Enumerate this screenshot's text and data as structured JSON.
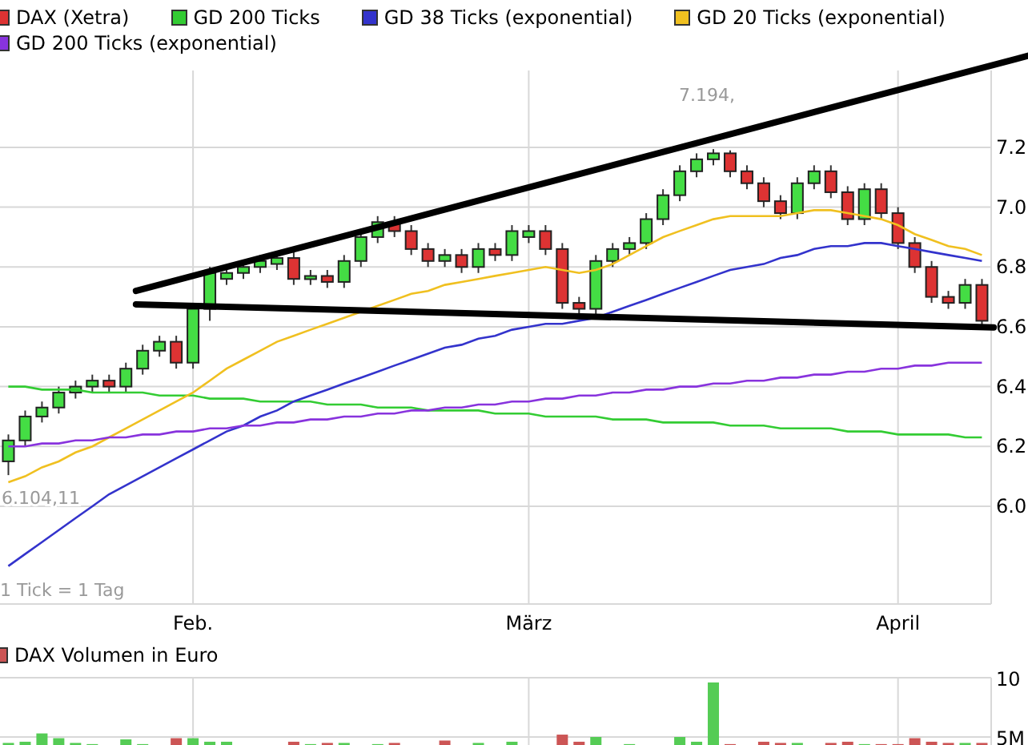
{
  "price_chart": {
    "main_series": {
      "name": "DAX (Xetra)",
      "color": "#dd3333"
    },
    "chart_data": {
      "type": "candlestick",
      "categories": [
        null,
        null,
        null,
        null,
        null,
        null,
        null,
        null,
        null,
        null,
        null,
        "Feb.",
        null,
        null,
        null,
        null,
        null,
        null,
        null,
        null,
        null,
        null,
        null,
        null,
        null,
        null,
        null,
        null,
        null,
        null,
        null,
        "März",
        null,
        null,
        null,
        null,
        null,
        null,
        null,
        null,
        null,
        null,
        null,
        null,
        null,
        null,
        null,
        null,
        null,
        null,
        null,
        null,
        null,
        "April",
        null,
        null,
        null,
        null,
        null
      ],
      "ylim": [
        5.673,
        7.457
      ],
      "grid": true,
      "yticks": [
        {
          "value": 7.2,
          "label": "7.2"
        },
        {
          "value": 7.0,
          "label": "7.0"
        },
        {
          "value": 6.8,
          "label": "6.8"
        },
        {
          "value": 6.6,
          "label": "6.6"
        },
        {
          "value": 6.4,
          "label": "6.4"
        },
        {
          "value": 6.2,
          "label": "6.2"
        },
        {
          "value": 6.0,
          "label": "6.0"
        }
      ],
      "ohlc": [
        [
          6.15,
          6.24,
          6.104,
          6.22
        ],
        [
          6.22,
          6.32,
          6.2,
          6.3
        ],
        [
          6.3,
          6.35,
          6.28,
          6.33
        ],
        [
          6.33,
          6.4,
          6.31,
          6.38
        ],
        [
          6.38,
          6.42,
          6.36,
          6.4
        ],
        [
          6.4,
          6.44,
          6.38,
          6.42
        ],
        [
          6.42,
          6.44,
          6.38,
          6.4
        ],
        [
          6.4,
          6.48,
          6.38,
          6.46
        ],
        [
          6.46,
          6.54,
          6.44,
          6.52
        ],
        [
          6.52,
          6.57,
          6.5,
          6.55
        ],
        [
          6.55,
          6.57,
          6.46,
          6.48
        ],
        [
          6.48,
          6.68,
          6.46,
          6.66
        ],
        [
          6.66,
          6.8,
          6.62,
          6.78
        ],
        [
          6.76,
          6.8,
          6.74,
          6.78
        ],
        [
          6.78,
          6.82,
          6.76,
          6.8
        ],
        [
          6.8,
          6.84,
          6.78,
          6.82
        ],
        [
          6.81,
          6.85,
          6.79,
          6.83
        ],
        [
          6.83,
          6.85,
          6.74,
          6.76
        ],
        [
          6.76,
          6.79,
          6.74,
          6.77
        ],
        [
          6.77,
          6.79,
          6.73,
          6.75
        ],
        [
          6.75,
          6.84,
          6.73,
          6.82
        ],
        [
          6.82,
          6.92,
          6.8,
          6.9
        ],
        [
          6.9,
          6.97,
          6.88,
          6.95
        ],
        [
          6.95,
          6.97,
          6.9,
          6.92
        ],
        [
          6.92,
          6.94,
          6.84,
          6.86
        ],
        [
          6.86,
          6.88,
          6.8,
          6.82
        ],
        [
          6.82,
          6.86,
          6.8,
          6.84
        ],
        [
          6.84,
          6.86,
          6.78,
          6.8
        ],
        [
          6.8,
          6.88,
          6.78,
          6.86
        ],
        [
          6.86,
          6.88,
          6.82,
          6.84
        ],
        [
          6.84,
          6.94,
          6.82,
          6.92
        ],
        [
          6.9,
          6.94,
          6.88,
          6.92
        ],
        [
          6.92,
          6.94,
          6.84,
          6.86
        ],
        [
          6.86,
          6.88,
          6.66,
          6.68
        ],
        [
          6.68,
          6.7,
          6.64,
          6.66
        ],
        [
          6.66,
          6.84,
          6.64,
          6.82
        ],
        [
          6.82,
          6.88,
          6.8,
          6.86
        ],
        [
          6.86,
          6.9,
          6.84,
          6.88
        ],
        [
          6.88,
          6.98,
          6.86,
          6.96
        ],
        [
          6.96,
          7.06,
          6.94,
          7.04
        ],
        [
          7.04,
          7.14,
          7.02,
          7.12
        ],
        [
          7.12,
          7.18,
          7.1,
          7.16
        ],
        [
          7.16,
          7.194,
          7.14,
          7.18
        ],
        [
          7.18,
          7.19,
          7.1,
          7.12
        ],
        [
          7.12,
          7.14,
          7.06,
          7.08
        ],
        [
          7.08,
          7.1,
          7.0,
          7.02
        ],
        [
          7.02,
          7.04,
          6.96,
          6.98
        ],
        [
          6.98,
          7.1,
          6.96,
          7.08
        ],
        [
          7.08,
          7.14,
          7.06,
          7.12
        ],
        [
          7.12,
          7.14,
          7.03,
          7.05
        ],
        [
          7.05,
          7.07,
          6.94,
          6.96
        ],
        [
          6.96,
          7.08,
          6.94,
          7.06
        ],
        [
          7.06,
          7.08,
          6.96,
          6.98
        ],
        [
          6.98,
          7.0,
          6.86,
          6.88
        ],
        [
          6.88,
          6.9,
          6.78,
          6.8
        ],
        [
          6.8,
          6.82,
          6.68,
          6.7
        ],
        [
          6.7,
          6.72,
          6.66,
          6.68
        ],
        [
          6.68,
          6.76,
          6.66,
          6.74
        ],
        [
          6.74,
          6.76,
          6.6,
          6.62
        ]
      ],
      "series": [
        {
          "name": "GD 200 Ticks",
          "type": "line",
          "color": "#33cc33",
          "values": [
            6.4,
            6.4,
            6.39,
            6.39,
            6.39,
            6.38,
            6.38,
            6.38,
            6.38,
            6.37,
            6.37,
            6.37,
            6.36,
            6.36,
            6.36,
            6.35,
            6.35,
            6.35,
            6.35,
            6.34,
            6.34,
            6.34,
            6.33,
            6.33,
            6.33,
            6.32,
            6.32,
            6.32,
            6.32,
            6.31,
            6.31,
            6.31,
            6.3,
            6.3,
            6.3,
            6.3,
            6.29,
            6.29,
            6.29,
            6.28,
            6.28,
            6.28,
            6.28,
            6.27,
            6.27,
            6.27,
            6.26,
            6.26,
            6.26,
            6.26,
            6.25,
            6.25,
            6.25,
            6.24,
            6.24,
            6.24,
            6.24,
            6.23,
            6.23
          ]
        },
        {
          "name": "GD 38 Ticks (exponential)",
          "type": "line",
          "color": "#3333cc",
          "values": [
            5.8,
            5.84,
            5.88,
            5.92,
            5.96,
            6.0,
            6.04,
            6.07,
            6.1,
            6.13,
            6.16,
            6.19,
            6.22,
            6.25,
            6.27,
            6.3,
            6.32,
            6.35,
            6.37,
            6.39,
            6.41,
            6.43,
            6.45,
            6.47,
            6.49,
            6.51,
            6.53,
            6.54,
            6.56,
            6.57,
            6.59,
            6.6,
            6.61,
            6.61,
            6.62,
            6.63,
            6.65,
            6.67,
            6.69,
            6.71,
            6.73,
            6.75,
            6.77,
            6.79,
            6.8,
            6.81,
            6.83,
            6.84,
            6.86,
            6.87,
            6.87,
            6.88,
            6.88,
            6.87,
            6.86,
            6.85,
            6.84,
            6.83,
            6.82
          ]
        },
        {
          "name": "GD 20 Ticks (exponential)",
          "type": "line",
          "color": "#f0c020",
          "values": [
            6.08,
            6.1,
            6.13,
            6.15,
            6.18,
            6.2,
            6.23,
            6.26,
            6.29,
            6.32,
            6.35,
            6.38,
            6.42,
            6.46,
            6.49,
            6.52,
            6.55,
            6.57,
            6.59,
            6.61,
            6.63,
            6.65,
            6.67,
            6.69,
            6.71,
            6.72,
            6.74,
            6.75,
            6.76,
            6.77,
            6.78,
            6.79,
            6.8,
            6.79,
            6.78,
            6.79,
            6.81,
            6.84,
            6.87,
            6.9,
            6.92,
            6.94,
            6.96,
            6.97,
            6.97,
            6.97,
            6.97,
            6.98,
            6.99,
            6.99,
            6.98,
            6.97,
            6.96,
            6.94,
            6.91,
            6.89,
            6.87,
            6.86,
            6.84
          ]
        },
        {
          "name": "GD 200 Ticks (exponential)",
          "type": "line",
          "color": "#8833dd",
          "values": [
            6.2,
            6.2,
            6.21,
            6.21,
            6.22,
            6.22,
            6.23,
            6.23,
            6.24,
            6.24,
            6.25,
            6.25,
            6.26,
            6.26,
            6.27,
            6.27,
            6.28,
            6.28,
            6.29,
            6.29,
            6.3,
            6.3,
            6.31,
            6.31,
            6.32,
            6.32,
            6.33,
            6.33,
            6.34,
            6.34,
            6.35,
            6.35,
            6.36,
            6.36,
            6.37,
            6.37,
            6.38,
            6.38,
            6.39,
            6.39,
            6.4,
            6.4,
            6.41,
            6.41,
            6.42,
            6.42,
            6.43,
            6.43,
            6.44,
            6.44,
            6.45,
            6.45,
            6.46,
            6.46,
            6.47,
            6.47,
            6.48,
            6.48,
            6.48
          ]
        }
      ],
      "annotations": [
        "7.194,",
        "6.104,11"
      ]
    },
    "note": "1 Tick = 1 Tag"
  },
  "volume_chart": {
    "chart_data": {
      "type": "bar",
      "ylim": [
        0,
        10
      ],
      "yticks": [
        {
          "value": 10,
          "label": "10"
        },
        {
          "value": 5,
          "label": "5M"
        }
      ],
      "series": [
        {
          "name": "DAX Volumen in Euro",
          "color": "#cc5555",
          "values": [
            null,
            null,
            null,
            null,
            null,
            null,
            null,
            null,
            null,
            null,
            4.9,
            null,
            null,
            null,
            null,
            null,
            null,
            4.6,
            null,
            4.5,
            null,
            null,
            null,
            4.5,
            null,
            null,
            4.7,
            null,
            null,
            null,
            null,
            null,
            null,
            5.2,
            4.6,
            null,
            null,
            null,
            null,
            null,
            null,
            null,
            null,
            4.4,
            null,
            4.6,
            4.5,
            null,
            null,
            4.5,
            4.6,
            null,
            4.4,
            4.4,
            4.9,
            4.6,
            4.5,
            null,
            4.5
          ]
        },
        {
          "color": "#55cc55",
          "values": [
            4.5,
            4.6,
            5.3,
            4.9,
            4.5,
            4.4,
            null,
            4.8,
            4.4,
            null,
            null,
            4.9,
            4.6,
            4.6,
            null,
            null,
            null,
            null,
            4.4,
            null,
            4.5,
            null,
            4.4,
            null,
            null,
            null,
            null,
            null,
            4.5,
            null,
            4.6,
            null,
            null,
            null,
            null,
            5.0,
            null,
            4.4,
            null,
            null,
            5.0,
            4.6,
            9.6,
            null,
            null,
            null,
            null,
            4.5,
            null,
            null,
            null,
            4.4,
            null,
            null,
            null,
            null,
            null,
            4.5,
            null
          ]
        }
      ]
    }
  }
}
